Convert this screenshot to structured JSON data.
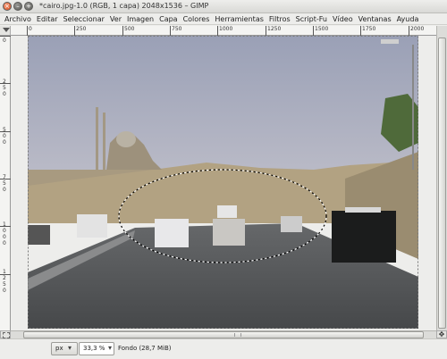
{
  "window": {
    "title": "*cairo.jpg-1.0 (RGB, 1 capa) 2048x1536 – GIMP",
    "controls": {
      "close": "×",
      "minimize": "–",
      "maximize": "+"
    }
  },
  "menu": [
    "Archivo",
    "Editar",
    "Seleccionar",
    "Ver",
    "Imagen",
    "Capa",
    "Colores",
    "Herramientas",
    "Filtros",
    "Script-Fu",
    "Vídeo",
    "Ventanas",
    "Ayuda"
  ],
  "rulers": {
    "horizontal": [
      "0",
      "250",
      "500",
      "750",
      "1000",
      "1250",
      "1500",
      "1750",
      "2000"
    ],
    "vertical": [
      "0",
      "2",
      "5",
      "0",
      "5",
      "0",
      "0",
      "7",
      "5",
      "0",
      "1",
      "0",
      "0",
      "0",
      "1",
      "2",
      "5",
      "0"
    ]
  },
  "statusbar": {
    "unit": "px",
    "zoom": "33,3 %",
    "text": "Fondo (28,7 MiB)",
    "dropdown_arrow": "▾"
  },
  "icons": {
    "window_close": "close-icon",
    "navigate": "navigate-icon",
    "quick_mask": "quick-mask-icon",
    "ruler_menu": "ruler-menu-icon"
  },
  "colors": {
    "canvas_bg": "#ededeb",
    "selection": "#000000",
    "close_button": "#d94c1d"
  }
}
